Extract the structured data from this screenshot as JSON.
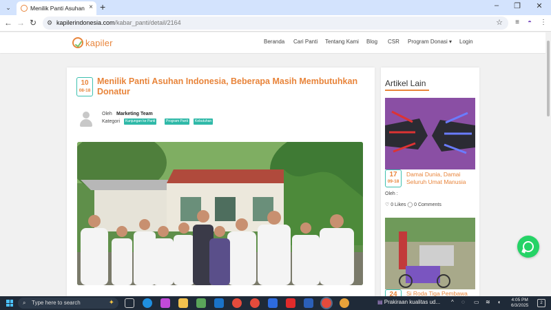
{
  "browser": {
    "tab_title": "Menilik Panti Asuhan Indonesia",
    "tab_close": "×",
    "new_tab": "+",
    "tab_menu": "⌄",
    "url_host": "kapilerindonesia.com",
    "url_path": "/kabar_panti/detail/2164",
    "minimize": "–",
    "maximize": "❐",
    "close": "✕",
    "back": "←",
    "forward": "→",
    "reload": "↻",
    "star": "☆",
    "more": "⋮"
  },
  "site": {
    "logo_text": "kapiler",
    "menu": [
      "Beranda",
      "Cari Panti",
      "Tentang Kami",
      "Blog",
      "CSR",
      "Program Donasi ▾",
      "Login"
    ]
  },
  "article": {
    "day": "10",
    "month": "08-18",
    "title": "Menilik Panti Asuhan Indonesia, Beberapa Masih Membutuhkan Donatur",
    "by_label": "Oleh",
    "author": "Marketing Team",
    "category_label": "Kategori",
    "tags": [
      "Kunjungan ke Panti",
      "Program Panti",
      "Kebutuhan"
    ]
  },
  "sidebar": {
    "title": "Artikel Lain",
    "items": [
      {
        "day": "17",
        "month": "09-18",
        "title": "Damai Dunia, Damai Seluruh Umat Manusia",
        "oleh": "Oleh :",
        "likes": "♡ 0 Likes",
        "comments": "◯ 0 Comments"
      },
      {
        "day": "24",
        "month": "",
        "title": "Si Roda Tiga Pembawa"
      }
    ]
  },
  "taskbar": {
    "search_placeholder": "Type here to search",
    "weather": "Prakiraan kualitas ud...",
    "time": "4:05 PM",
    "date": "6/3/2025",
    "notif_count": "2"
  },
  "colors": {
    "accent": "#e8843a",
    "teal": "#2fb9a8",
    "whatsapp": "#25d366"
  }
}
